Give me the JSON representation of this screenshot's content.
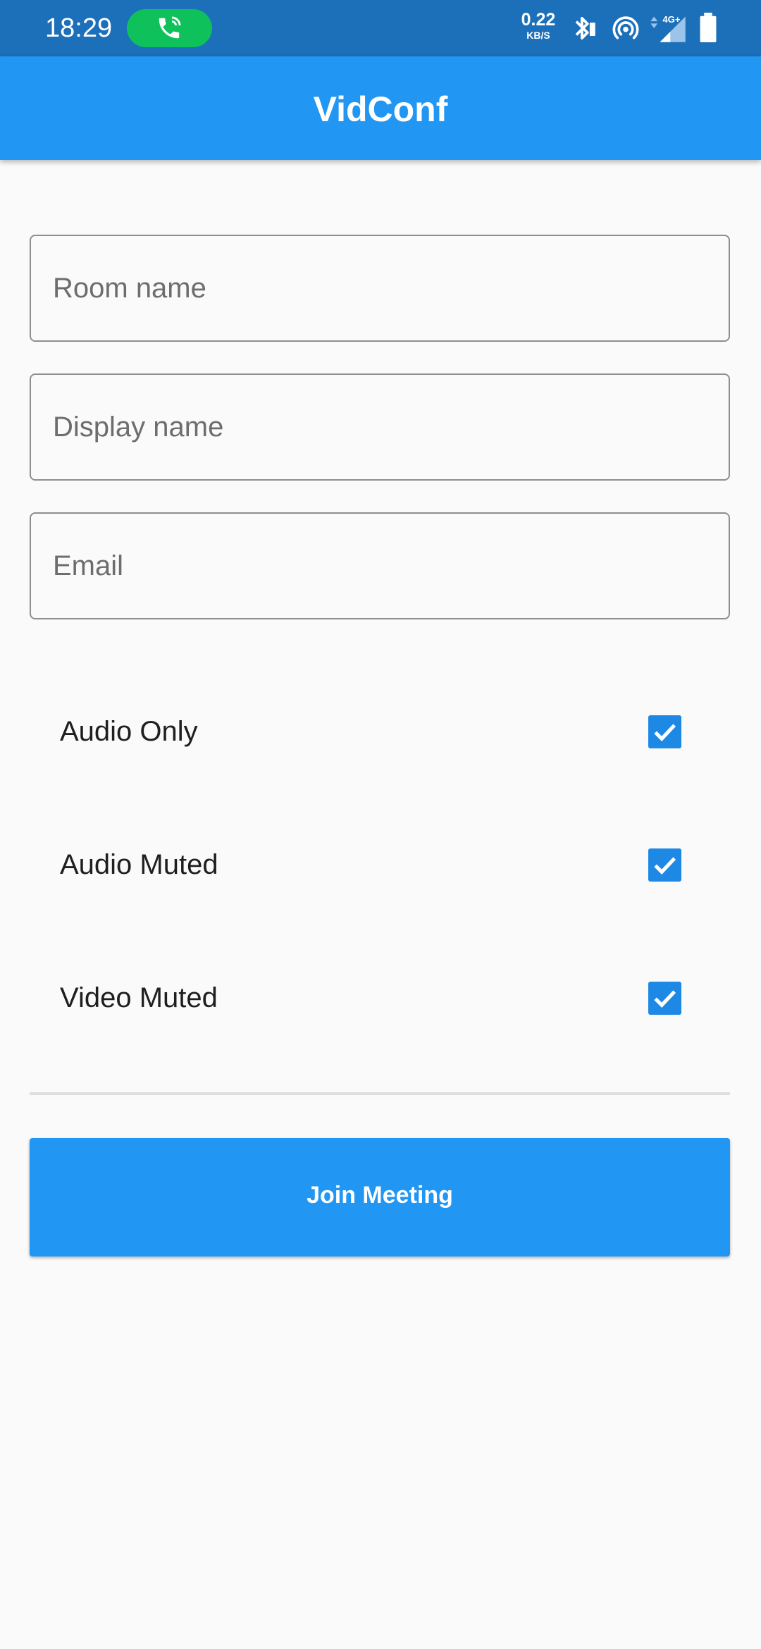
{
  "status_bar": {
    "time": "18:29",
    "net_speed_value": "0.22",
    "net_speed_unit": "KB/S",
    "network_type": "4G+",
    "icons": [
      "ongoing-call-icon",
      "bluetooth-icon",
      "hotspot-icon",
      "signal-icon",
      "battery-icon"
    ]
  },
  "app_bar": {
    "title": "VidConf"
  },
  "form": {
    "room_name": {
      "placeholder": "Room name",
      "value": ""
    },
    "display_name": {
      "placeholder": "Display name",
      "value": ""
    },
    "email": {
      "placeholder": "Email",
      "value": ""
    }
  },
  "options": [
    {
      "label": "Audio Only",
      "checked": true
    },
    {
      "label": "Audio Muted",
      "checked": true
    },
    {
      "label": "Video Muted",
      "checked": true
    }
  ],
  "join_button": {
    "label": "Join Meeting"
  },
  "colors": {
    "status_bar": "#1c6fb9",
    "primary": "#2196f3",
    "checkbox": "#1e88e5",
    "call_pill": "#0fc15b",
    "background": "#fafafa"
  }
}
